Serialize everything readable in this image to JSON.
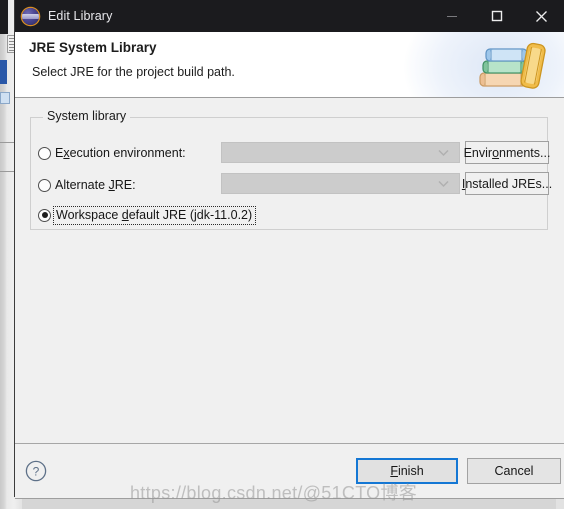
{
  "window": {
    "title": "Edit Library",
    "app_icon": "eclipse-icon",
    "controls": {
      "minimize": "minimize-icon",
      "maximize": "maximize-icon",
      "close": "close-icon"
    }
  },
  "header": {
    "title": "JRE System Library",
    "subtitle": "Select JRE for the project build path.",
    "icon": "books-stack-icon"
  },
  "group": {
    "legend": "System library",
    "options": [
      {
        "id": "execution-environment",
        "label_pre": "E",
        "label_mnemonic": "x",
        "label_post": "ecution environment:",
        "label_full": "Execution environment:",
        "selected": false,
        "combo_value": "",
        "combo_enabled": false,
        "button_label_pre": "Envir",
        "button_mnemonic": "o",
        "button_label_post": "nments...",
        "button_label_full": "Environments..."
      },
      {
        "id": "alternate-jre",
        "label_pre": "Alternate ",
        "label_mnemonic": "J",
        "label_post": "RE:",
        "label_full": "Alternate JRE:",
        "selected": false,
        "combo_value": "",
        "combo_enabled": false,
        "button_label_pre": "",
        "button_mnemonic": "I",
        "button_label_post": "nstalled JREs...",
        "button_label_full": "Installed JREs..."
      },
      {
        "id": "workspace-default-jre",
        "label_pre": "Workspace ",
        "label_mnemonic": "d",
        "label_post": "efault JRE (jdk-11.0.2)",
        "label_full": "Workspace default JRE (jdk-11.0.2)",
        "selected": true,
        "focused": true
      }
    ]
  },
  "footer": {
    "help_icon": "question-mark-icon",
    "finish_pre": "",
    "finish_mnemonic": "F",
    "finish_post": "inish",
    "finish_label": "Finish",
    "cancel_label": "Cancel"
  },
  "watermark": {
    "text": "https://blog.csdn.net/@51CTO博客"
  },
  "colors": {
    "titlebar": "#1b1b1e",
    "default_button_border": "#1477d4",
    "dialog_bg": "#f0f0f0",
    "header_bg": "#ffffff"
  }
}
